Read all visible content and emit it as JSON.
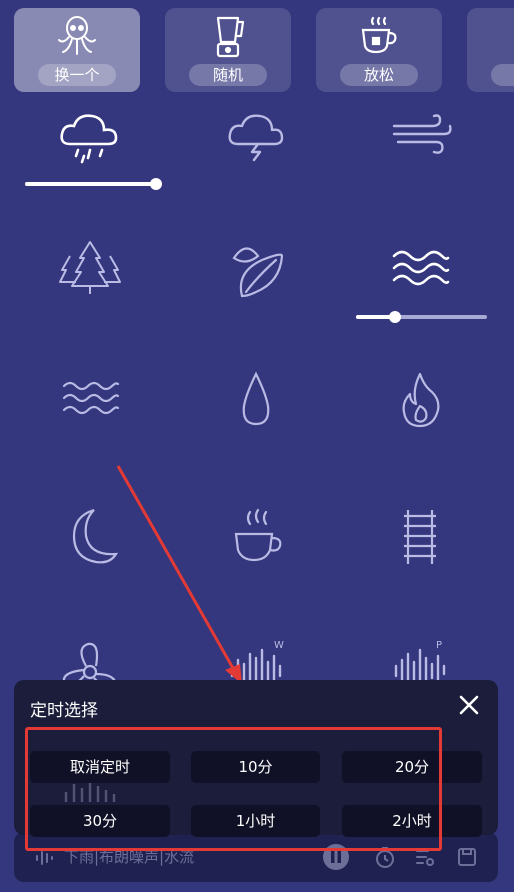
{
  "presets": [
    {
      "label": "换一个",
      "icon": "octopus-icon",
      "selected": true
    },
    {
      "label": "随机",
      "icon": "blender-icon",
      "selected": false
    },
    {
      "label": "放松",
      "icon": "teacup-icon",
      "selected": false
    },
    {
      "label": "",
      "icon": "partial-preset",
      "selected": false
    }
  ],
  "sounds": [
    {
      "icon": "rain-cloud-icon",
      "level": 1.0
    },
    {
      "icon": "thunder-cloud-icon"
    },
    {
      "icon": "wind-icon"
    },
    {
      "icon": "forest-icon"
    },
    {
      "icon": "leaf-icon"
    },
    {
      "icon": "waves-icon",
      "level": 0.3
    },
    {
      "icon": "ocean-icon"
    },
    {
      "icon": "water-drop-icon"
    },
    {
      "icon": "fire-icon"
    },
    {
      "icon": "moon-icon"
    },
    {
      "icon": "coffee-cup-icon"
    },
    {
      "icon": "railroad-icon"
    },
    {
      "icon": "fan-icon"
    },
    {
      "icon": "white-noise-icon"
    },
    {
      "icon": "pink-noise-icon"
    }
  ],
  "player": {
    "now_playing": "下雨|布朗噪声|水流"
  },
  "timer_modal": {
    "title": "定时选择",
    "options": [
      "取消定时",
      "10分",
      "20分",
      "30分",
      "1小时",
      "2小时"
    ]
  },
  "colors": {
    "background": "#34367e",
    "modal": "#1b1d3a",
    "highlight": "#e43a36"
  }
}
